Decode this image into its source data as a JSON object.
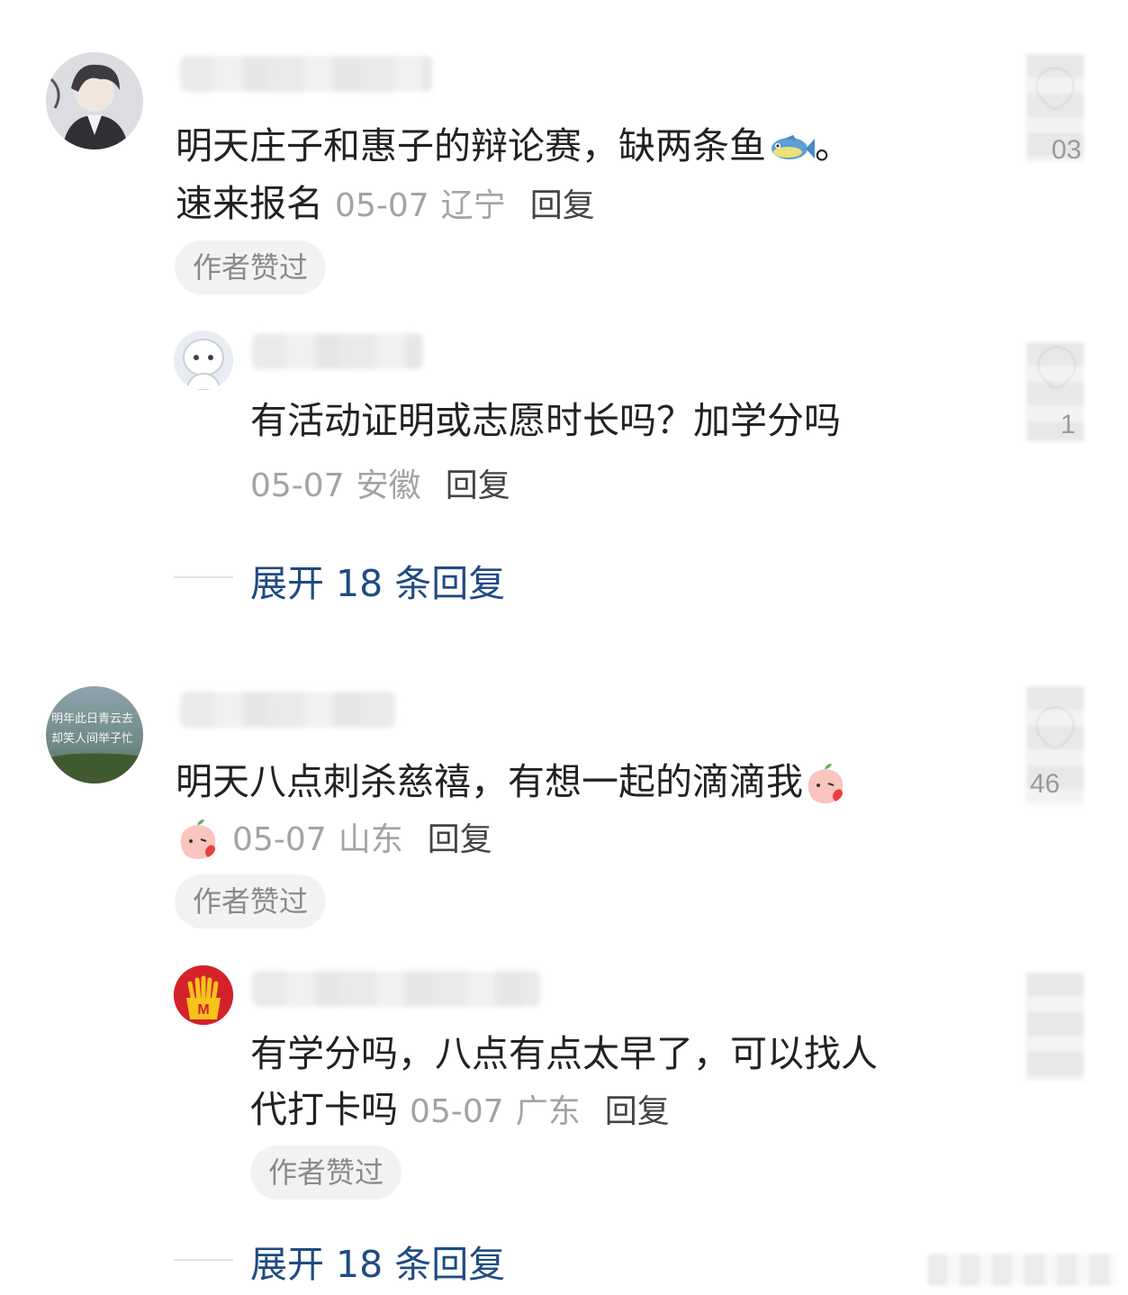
{
  "comments": [
    {
      "text_line1": "明天庄子和惠子的辩论赛，缺两条鱼",
      "text_line1_end": "。",
      "text_line2": "速来报名",
      "date": "05-07",
      "location": "辽宁",
      "reply_label": "回复",
      "badge": "作者赞过",
      "emoji": "fish-emoji",
      "reply": {
        "text": "有活动证明或志愿时长吗？加学分吗",
        "date": "05-07",
        "location": "安徽",
        "reply_label": "回复"
      },
      "expand_label": "展开 18 条回复"
    },
    {
      "text_line1": "明天八点刺杀慈禧，有想一起的滴滴我",
      "date": "05-07",
      "location": "山东",
      "reply_label": "回复",
      "badge": "作者赞过",
      "emoji": "peach-blowing-kiss-emoji",
      "avatar_caption_line1": "明年此日青云去",
      "avatar_caption_line2": "却笑人间举子忙",
      "reply": {
        "text_line1": "有学分吗，八点有点太早了，可以找人",
        "text_line2": "代打卡吗",
        "date": "05-07",
        "location": "广东",
        "reply_label": "回复",
        "badge": "作者赞过"
      },
      "expand_label": "展开 18 条回复"
    }
  ],
  "like_counts": [
    "03",
    "1",
    "46"
  ],
  "colors": {
    "link": "#1f4b82",
    "meta": "#a3a3a3",
    "badge_bg": "#f2f2f2"
  }
}
